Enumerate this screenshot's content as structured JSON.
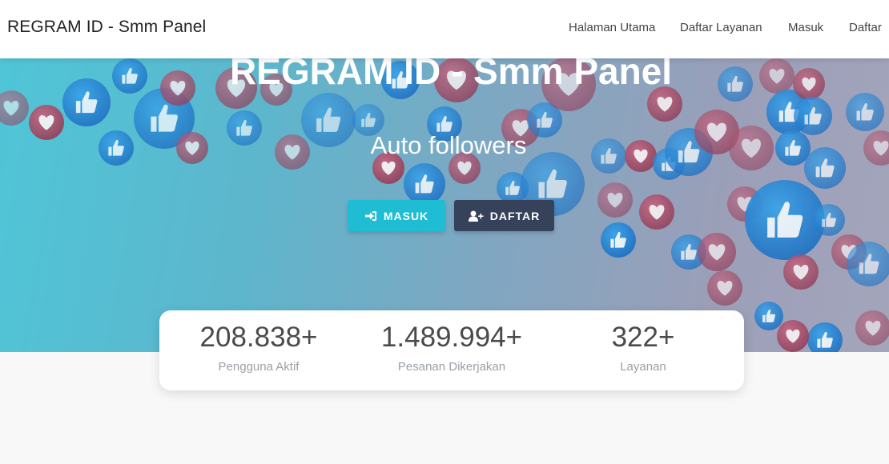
{
  "navbar": {
    "brand": "REGRAM ID - Smm Panel",
    "links": [
      {
        "label": "Halaman Utama"
      },
      {
        "label": "Daftar Layanan"
      },
      {
        "label": "Masuk"
      },
      {
        "label": "Daftar"
      }
    ]
  },
  "hero": {
    "title": "REGRAM ID - Smm Panel",
    "subtitle": "Auto followers",
    "buttons": {
      "masuk": {
        "label": "MASUK",
        "icon": "sign-in-icon"
      },
      "daftar": {
        "label": "DAFTAR",
        "icon": "user-plus-icon"
      }
    }
  },
  "stats": [
    {
      "value": "208.838+",
      "label": "Pengguna Aktif"
    },
    {
      "value": "1.489.994+",
      "label": "Pesanan Dikerjakan"
    },
    {
      "value": "322+",
      "label": "Layanan"
    }
  ],
  "colors": {
    "masuk_button": "#1fbdd4",
    "daftar_button": "#36415a",
    "like_bubble": "#2a8bd6",
    "heart_bubble": "#b2566e"
  }
}
